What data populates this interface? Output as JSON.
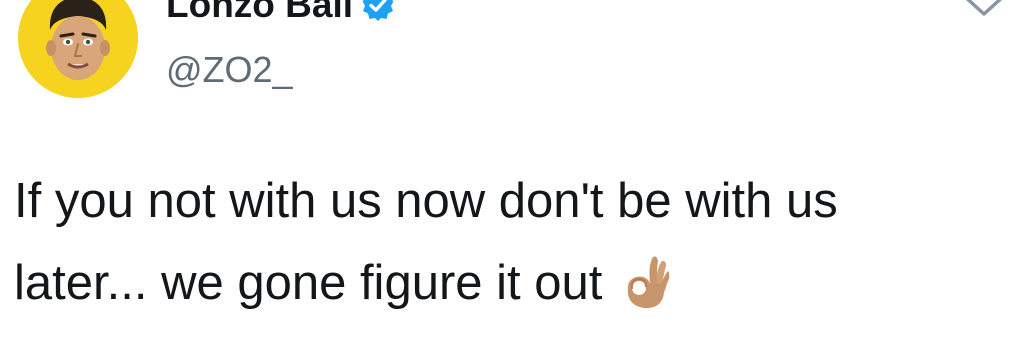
{
  "tweet": {
    "display_name": "Lonzo Ball",
    "handle": "@ZO2_",
    "verified": true,
    "text_line1": "If you not with us now don't be with us",
    "text_line2": "later... we gone figure it out",
    "emoji": "ok-hand-icon"
  },
  "icons": {
    "verified": "verified-badge-icon",
    "more": "chevron-down-icon",
    "avatar": "cartoon-face-avatar"
  },
  "colors": {
    "verified_blue": "#1da1f2",
    "avatar_bg": "#f5d31e",
    "text": "#14171a",
    "secondary_text": "#606b76",
    "emoji_skin": "#c8956a"
  }
}
